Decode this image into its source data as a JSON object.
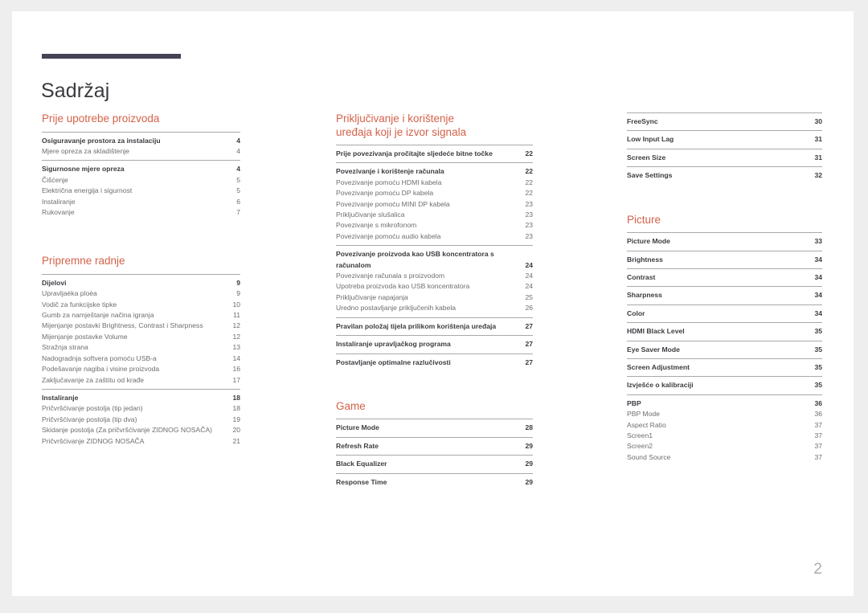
{
  "document": {
    "title": "Sadržaj",
    "folio": "2",
    "accent_color": "#d4624a",
    "rule_color": "#474355"
  },
  "columns": [
    {
      "name": "column-left",
      "sections": [
        {
          "heading": "Prije upotrebe proizvoda",
          "groups": [
            {
              "entries": [
                {
                  "label": "Osiguravanje prostora za instalaciju",
                  "page": "4",
                  "level": 1
                },
                {
                  "label": "Mjere opreza za skladištenje",
                  "page": "4",
                  "level": 2
                }
              ]
            },
            {
              "entries": [
                {
                  "label": "Sigurnosne mjere opreza",
                  "page": "4",
                  "level": 1
                },
                {
                  "label": "Čišćenje",
                  "page": "5",
                  "level": 2
                },
                {
                  "label": "Električna energija i sigurnost",
                  "page": "5",
                  "level": 2
                },
                {
                  "label": "Instaliranje",
                  "page": "6",
                  "level": 2
                },
                {
                  "label": "Rukovanje",
                  "page": "7",
                  "level": 2
                }
              ]
            }
          ]
        },
        {
          "heading": "Pripremne radnje",
          "groups": [
            {
              "entries": [
                {
                  "label": "Dijelovi",
                  "page": "9",
                  "level": 1
                },
                {
                  "label": "Upravljaėka ploėa",
                  "page": "9",
                  "level": 2
                },
                {
                  "label": "Vodič za funkcijske tipke",
                  "page": "10",
                  "level": 2
                },
                {
                  "label": "Gumb za namještanje načina igranja",
                  "page": "11",
                  "level": 2
                },
                {
                  "label": "Mijenjanje postavki Brightness, Contrast i Sharpness",
                  "page": "12",
                  "level": 2,
                  "wrap": true
                },
                {
                  "label": "Mijenjanje postavke Volume",
                  "page": "12",
                  "level": 2
                },
                {
                  "label": "Stražnja strana",
                  "page": "13",
                  "level": 2
                },
                {
                  "label": "Nadogradnja softvera pomoću USB-a",
                  "page": "14",
                  "level": 2
                },
                {
                  "label": "Podešavanje nagiba i visine proizvoda",
                  "page": "16",
                  "level": 2
                },
                {
                  "label": "Zaključavanje za zaštitu od krađe",
                  "page": "17",
                  "level": 2
                }
              ]
            },
            {
              "entries": [
                {
                  "label": "Instaliranje",
                  "page": "18",
                  "level": 1
                },
                {
                  "label": "Pričvršćivanje postolja (tip jedan)",
                  "page": "18",
                  "level": 2
                },
                {
                  "label": "Pričvršćivanje postolja (tip dva)",
                  "page": "19",
                  "level": 2
                },
                {
                  "label": "Skidanje postolja (Za pričvršćivanje ZIDNOG NOSAČA)",
                  "page": "20",
                  "level": 2,
                  "wrap": true
                },
                {
                  "label": "Pričvršćivanje ZIDNOG NOSAČA",
                  "page": "21",
                  "level": 2
                }
              ]
            }
          ]
        }
      ]
    },
    {
      "name": "column-middle",
      "sections": [
        {
          "heading": "Priključivanje i korištenje\nuređaja koji je izvor signala",
          "groups": [
            {
              "entries": [
                {
                  "label": "Prije povezivanja pročitajte sljedeće bitne točke",
                  "page": "22",
                  "level": 1
                }
              ]
            },
            {
              "entries": [
                {
                  "label": "Povezivanje i korištenje računala",
                  "page": "22",
                  "level": 1
                },
                {
                  "label": "Povezivanje pomoću HDMI kabela",
                  "page": "22",
                  "level": 2
                },
                {
                  "label": "Povezivanje pomoću DP kabela",
                  "page": "22",
                  "level": 2
                },
                {
                  "label": "Povezivanje pomoću MINI DP kabela",
                  "page": "23",
                  "level": 2
                },
                {
                  "label": "Priključivanje slušalica",
                  "page": "23",
                  "level": 2
                },
                {
                  "label": "Povezivanje s mikrofonom",
                  "page": "23",
                  "level": 2
                },
                {
                  "label": "Povezivanje pomoću audio kabela",
                  "page": "23",
                  "level": 2
                }
              ]
            },
            {
              "entries": [
                {
                  "label": "Povezivanje proizvoda kao USB koncentratora s računalom",
                  "page": "24",
                  "level": 1,
                  "wrap": true
                },
                {
                  "label": "Povezivanje računala s proizvodom",
                  "page": "24",
                  "level": 2
                },
                {
                  "label": "Upotreba proizvoda kao USB koncentratora",
                  "page": "24",
                  "level": 2
                },
                {
                  "label": "Priključivanje napajanja",
                  "page": "25",
                  "level": 2
                },
                {
                  "label": "Uredno postavljanje priključenih kabela",
                  "page": "26",
                  "level": 2
                }
              ]
            },
            {
              "entries": [
                {
                  "label": "Pravilan položaj tijela prilikom korištenja uređaja",
                  "page": "27",
                  "level": 1
                }
              ]
            },
            {
              "entries": [
                {
                  "label": "Instaliranje upravljačkog programa",
                  "page": "27",
                  "level": 1
                }
              ]
            },
            {
              "entries": [
                {
                  "label": "Postavljanje optimalne razlučivosti",
                  "page": "27",
                  "level": 1
                }
              ]
            }
          ]
        },
        {
          "heading": "Game",
          "groups": [
            {
              "entries": [
                {
                  "label": "Picture Mode",
                  "page": "28",
                  "level": 1
                }
              ]
            },
            {
              "entries": [
                {
                  "label": "Refresh Rate",
                  "page": "29",
                  "level": 1
                }
              ]
            },
            {
              "entries": [
                {
                  "label": "Black Equalizer",
                  "page": "29",
                  "level": 1
                }
              ]
            },
            {
              "entries": [
                {
                  "label": "Response Time",
                  "page": "29",
                  "level": 1
                }
              ]
            }
          ]
        }
      ]
    },
    {
      "name": "column-right",
      "sections": [
        {
          "heading": "",
          "groups": [
            {
              "entries": [
                {
                  "label": "FreeSync",
                  "page": "30",
                  "level": 1
                }
              ]
            },
            {
              "entries": [
                {
                  "label": "Low Input Lag",
                  "page": "31",
                  "level": 1
                }
              ]
            },
            {
              "entries": [
                {
                  "label": "Screen Size",
                  "page": "31",
                  "level": 1
                }
              ]
            },
            {
              "entries": [
                {
                  "label": "Save Settings",
                  "page": "32",
                  "level": 1
                }
              ]
            }
          ]
        },
        {
          "heading": "Picture",
          "groups": [
            {
              "entries": [
                {
                  "label": "Picture Mode",
                  "page": "33",
                  "level": 1
                }
              ]
            },
            {
              "entries": [
                {
                  "label": "Brightness",
                  "page": "34",
                  "level": 1
                }
              ]
            },
            {
              "entries": [
                {
                  "label": "Contrast",
                  "page": "34",
                  "level": 1
                }
              ]
            },
            {
              "entries": [
                {
                  "label": "Sharpness",
                  "page": "34",
                  "level": 1
                }
              ]
            },
            {
              "entries": [
                {
                  "label": "Color",
                  "page": "34",
                  "level": 1
                }
              ]
            },
            {
              "entries": [
                {
                  "label": "HDMI Black Level",
                  "page": "35",
                  "level": 1
                }
              ]
            },
            {
              "entries": [
                {
                  "label": "Eye Saver Mode",
                  "page": "35",
                  "level": 1
                }
              ]
            },
            {
              "entries": [
                {
                  "label": "Screen Adjustment",
                  "page": "35",
                  "level": 1
                }
              ]
            },
            {
              "entries": [
                {
                  "label": "Izvješće o kalibraciji",
                  "page": "35",
                  "level": 1
                }
              ]
            },
            {
              "entries": [
                {
                  "label": "PBP",
                  "page": "36",
                  "level": 1
                },
                {
                  "label": "PBP Mode",
                  "page": "36",
                  "level": 2
                },
                {
                  "label": "Aspect Ratio",
                  "page": "37",
                  "level": 2
                },
                {
                  "label": "Screen1",
                  "page": "37",
                  "level": 2
                },
                {
                  "label": "Screen2",
                  "page": "37",
                  "level": 2
                },
                {
                  "label": "Sound Source",
                  "page": "37",
                  "level": 2
                }
              ]
            }
          ]
        }
      ]
    }
  ]
}
